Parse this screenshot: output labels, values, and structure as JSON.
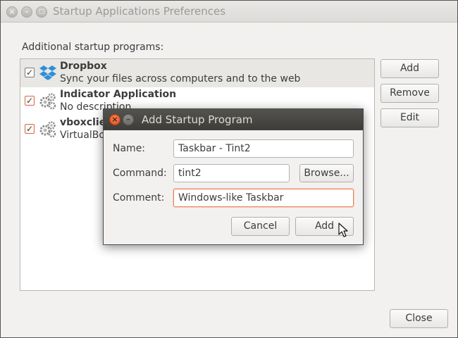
{
  "window": {
    "title": "Startup Applications Preferences",
    "close_glyph": "×",
    "minimize_glyph": "–",
    "maximize_glyph": "□"
  },
  "main": {
    "section_label": "Additional startup programs:",
    "programs": [
      {
        "name": "Dropbox",
        "description": "Sync your files across computers and to the web",
        "checked": true,
        "icon": "dropbox-icon"
      },
      {
        "name": "Indicator Application",
        "description": "No description",
        "checked": true,
        "icon": "gears-icon"
      },
      {
        "name": "vboxclient",
        "description": "VirtualBox",
        "checked": true,
        "icon": "gears-icon"
      }
    ],
    "checkmark": "✓",
    "buttons": {
      "add": "Add",
      "remove": "Remove",
      "edit": "Edit",
      "close": "Close"
    }
  },
  "dialog": {
    "title": "Add Startup Program",
    "close_glyph": "×",
    "minimize_glyph": "–",
    "name_label": "Name:",
    "name_value": "Taskbar - Tint2",
    "command_label": "Command:",
    "command_value": "tint2",
    "browse_label": "Browse...",
    "comment_label": "Comment:",
    "comment_value": "Windows-like Taskbar",
    "cancel_label": "Cancel",
    "add_label": "Add"
  },
  "colors": {
    "accent": "#dd4814",
    "focus": "#e9865d",
    "dialog_title_bg": "#3d3c39",
    "dropbox_blue": "#2f8fd8"
  }
}
